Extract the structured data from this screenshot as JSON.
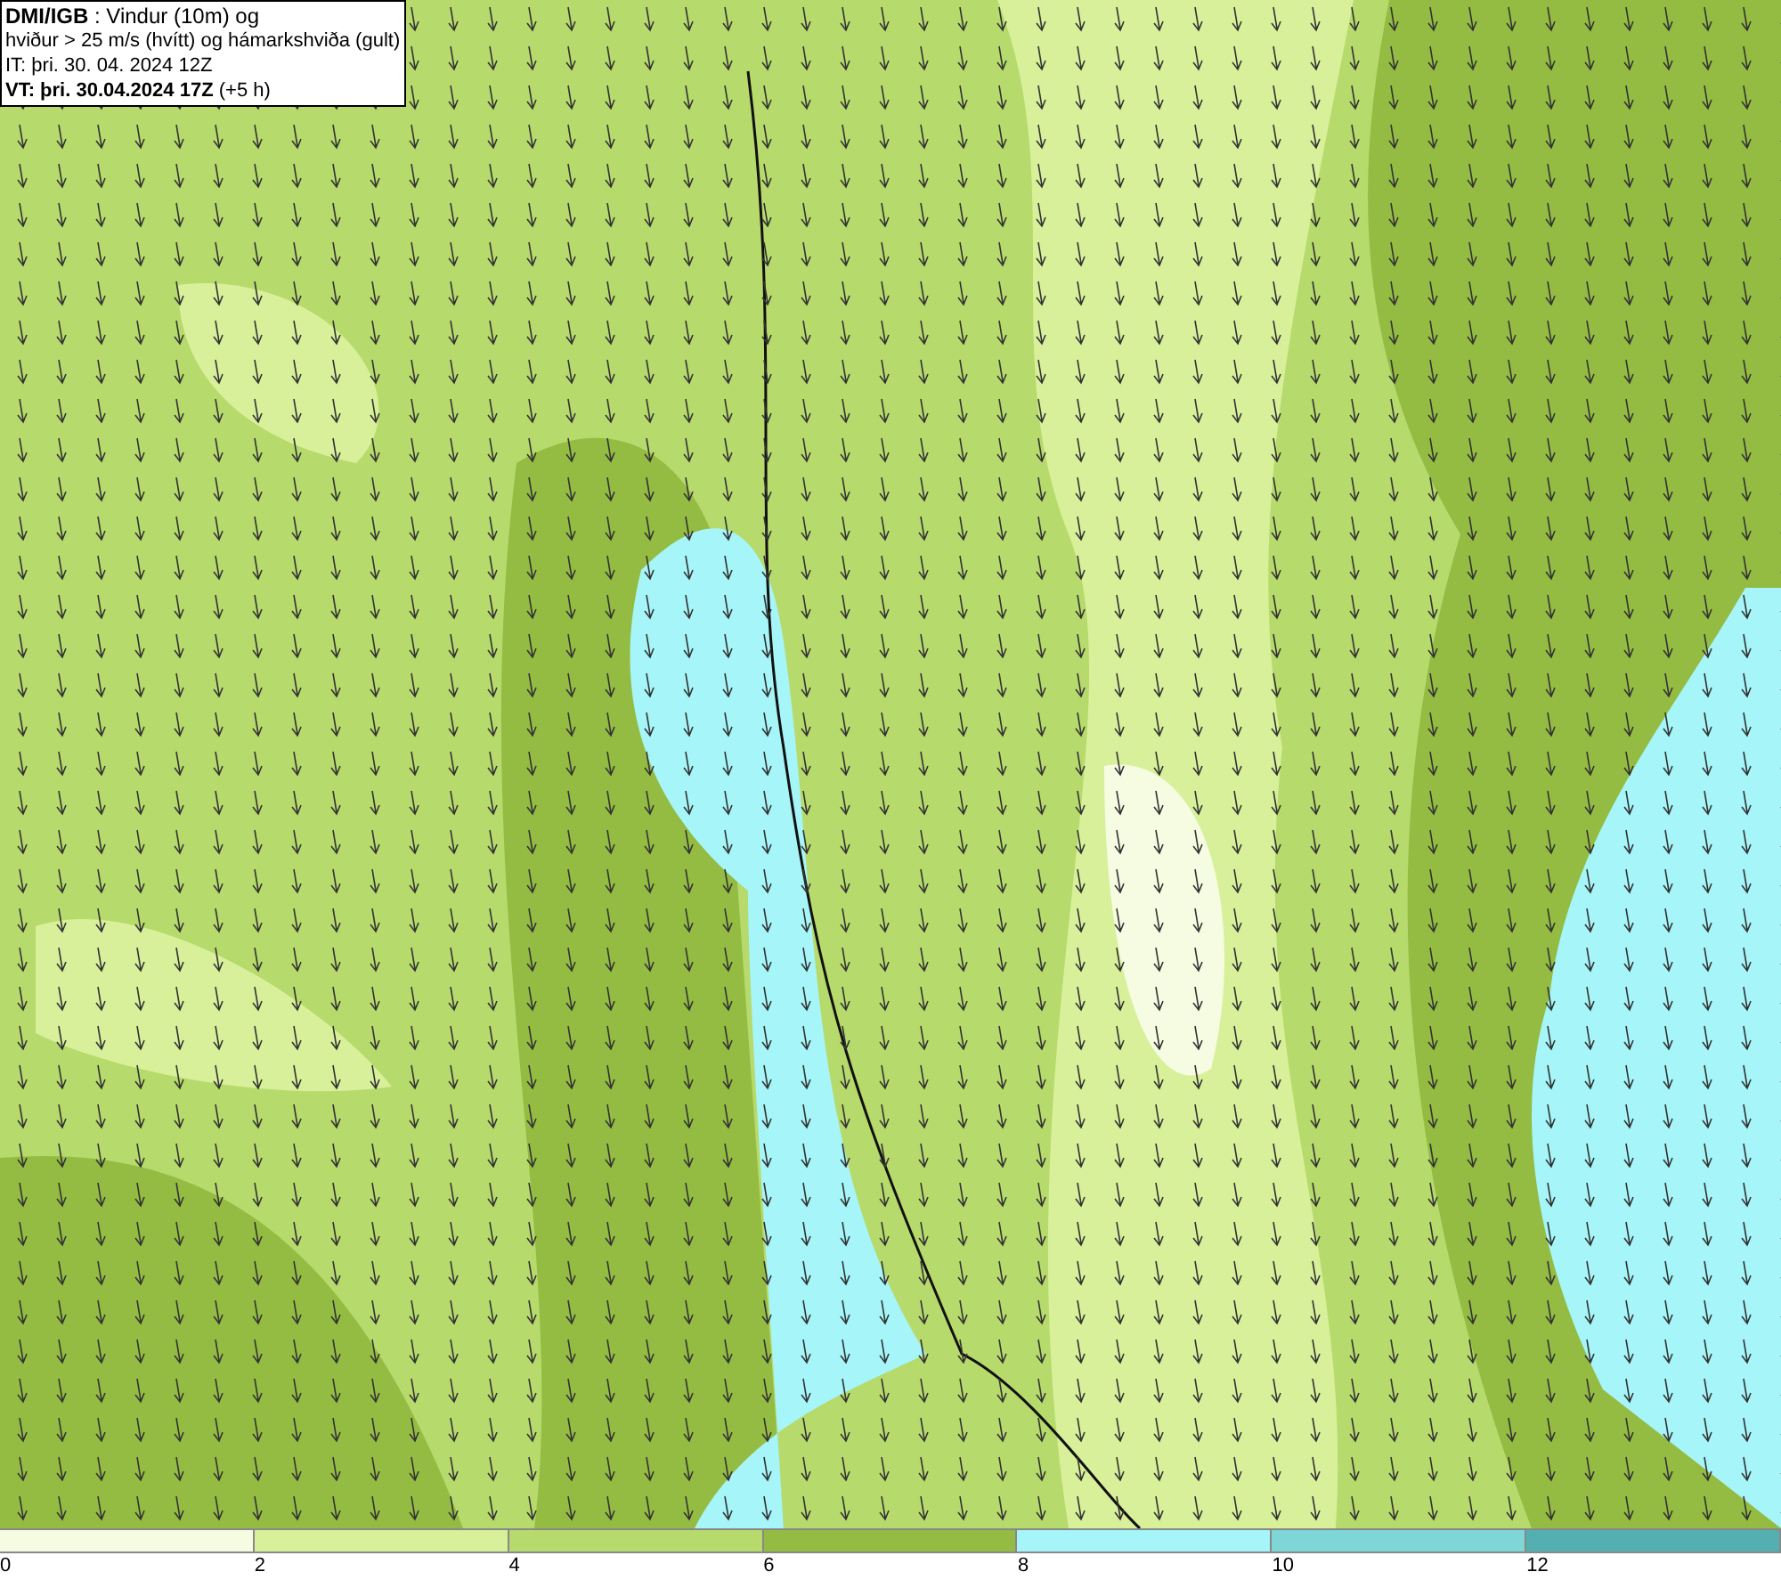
{
  "info_box": {
    "line_1": "**DMI/IGB** : Vindur (10m) og",
    "line_2": "hviður > 25 m/s (hvítt) og hámarkshviða (gult)",
    "line_3": "IT: þri. 30. 04. 2024 12Z",
    "line_4": "**VT: þri. 30.04.2024 17Z** (+5 h)"
  },
  "legend": {
    "bins": [
      {
        "color": "#f5fce2"
      },
      {
        "color": "#d8f09a"
      },
      {
        "color": "#b7da6c"
      },
      {
        "color": "#94bc42"
      },
      {
        "color": "#a6f5f8"
      },
      {
        "color": "#7ed6d6"
      },
      {
        "color": "#54b0b0"
      }
    ],
    "ticks": [
      "0",
      "2",
      "4",
      "6",
      "8",
      "10",
      "12"
    ]
  }
}
